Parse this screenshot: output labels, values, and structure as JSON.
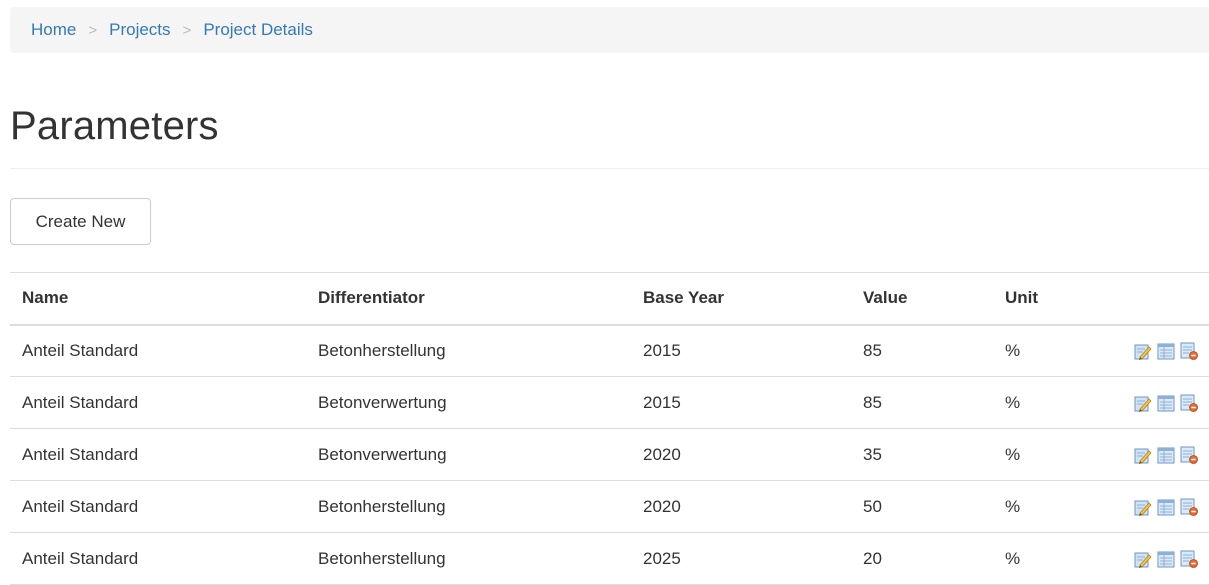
{
  "breadcrumb": {
    "items": [
      "Home",
      "Projects",
      "Project Details"
    ],
    "separator": ">"
  },
  "page": {
    "title": "Parameters",
    "create_button": "Create New"
  },
  "table": {
    "columns": [
      "Name",
      "Differentiator",
      "Base Year",
      "Value",
      "Unit"
    ],
    "rows": [
      [
        "Anteil Standard",
        "Betonherstellung",
        "2015",
        "85",
        "%"
      ],
      [
        "Anteil Standard",
        "Betonverwertung",
        "2015",
        "85",
        "%"
      ],
      [
        "Anteil Standard",
        "Betonverwertung",
        "2020",
        "35",
        "%"
      ],
      [
        "Anteil Standard",
        "Betonherstellung",
        "2020",
        "50",
        "%"
      ],
      [
        "Anteil Standard",
        "Betonherstellung",
        "2025",
        "20",
        "%"
      ]
    ],
    "row_action_icons": [
      "edit-icon",
      "details-icon",
      "delete-icon"
    ]
  },
  "colors": {
    "link": "#337ab7",
    "breadcrumb_bg": "#f5f5f5",
    "text": "#333333",
    "border": "#dddddd"
  }
}
